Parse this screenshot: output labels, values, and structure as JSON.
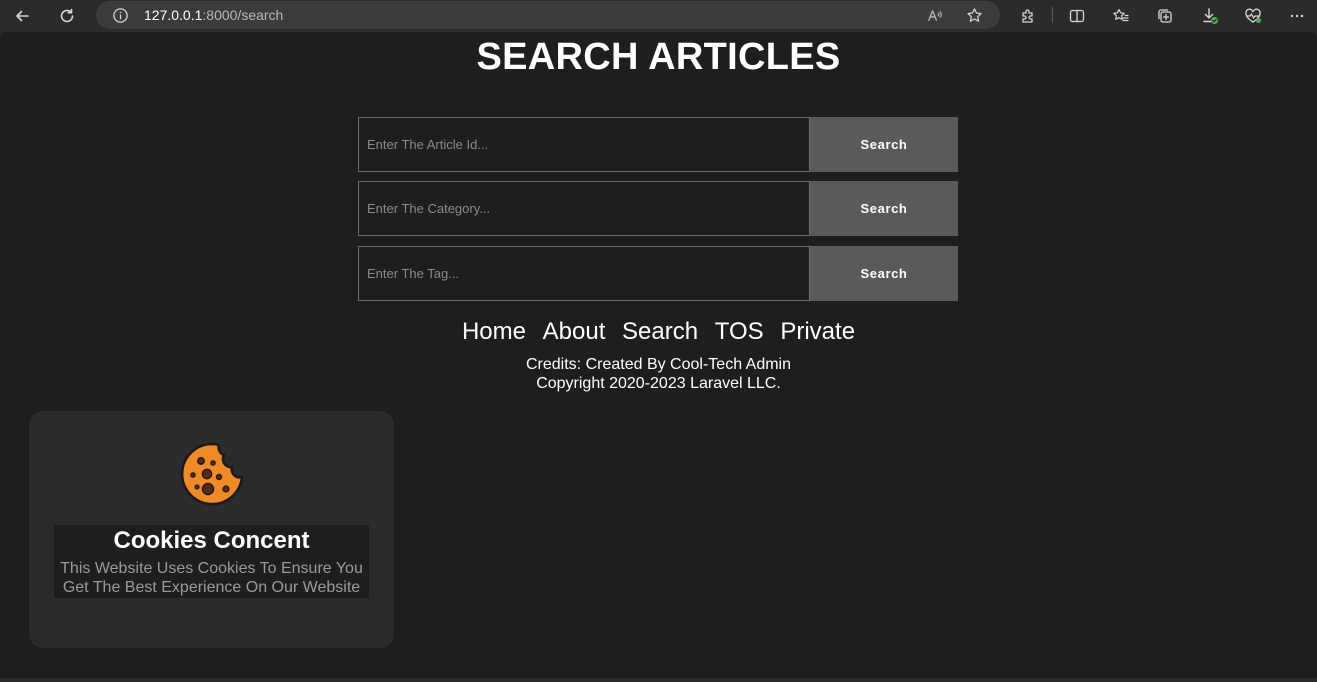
{
  "browser": {
    "url_host": "127.0.0.1",
    "url_rest": ":8000/search"
  },
  "page": {
    "title": "SEARCH ARTICLES"
  },
  "search_forms": [
    {
      "placeholder": "Enter The Article Id...",
      "button_label": "Search"
    },
    {
      "placeholder": "Enter The Category...",
      "button_label": "Search"
    },
    {
      "placeholder": "Enter The Tag...",
      "button_label": "Search"
    }
  ],
  "footer": {
    "nav": [
      "Home",
      "About",
      "Search",
      "TOS",
      "Private"
    ],
    "credits": "Credits: Created By Cool-Tech Admin",
    "copyright": "Copyright 2020-2023 Laravel LLC."
  },
  "cookie_banner": {
    "icon": "cookie-icon",
    "title": "Cookies Concent",
    "message": "This Website Uses Cookies To Ensure You Get The Best Experience On Our Website"
  },
  "colors": {
    "page_bg": "#1e1e1e",
    "button_bg": "#5a5a5a",
    "cookie_orange": "#f08a24"
  }
}
